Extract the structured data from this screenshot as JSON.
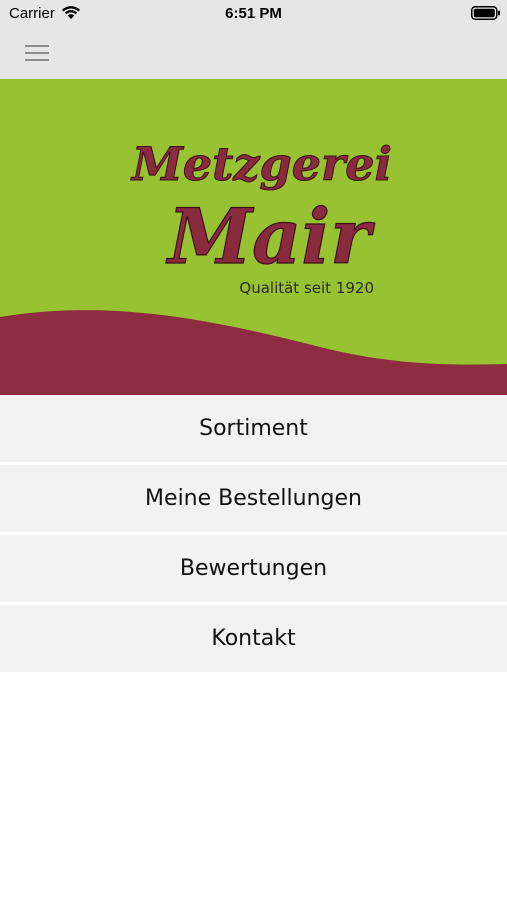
{
  "status_bar": {
    "carrier": "Carrier",
    "time": "6:51 PM",
    "icons": [
      "wifi-icon",
      "battery-icon"
    ]
  },
  "nav_bar": {
    "menu_icon": "hamburger-menu-icon"
  },
  "header": {
    "logo_line1": "Metzgerei",
    "logo_line2": "Mair",
    "tagline": "Qualität seit 1920"
  },
  "menu": {
    "items": [
      {
        "label": "Sortiment"
      },
      {
        "label": "Meine Bestellungen"
      },
      {
        "label": "Bewertungen"
      },
      {
        "label": "Kontakt"
      }
    ]
  },
  "colors": {
    "brand_green": "#97c332",
    "brand_wine": "#8e2c41",
    "logo_fill": "#8a2a3f",
    "bar_background": "#e6e6e6",
    "menu_background": "#f2f2f2"
  }
}
